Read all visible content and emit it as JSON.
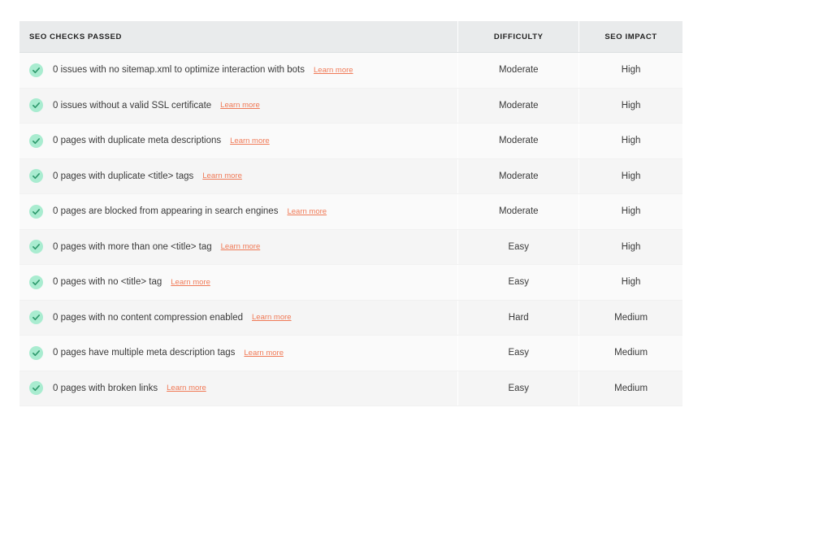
{
  "header": {
    "check_label": "SEO CHECKS PASSED",
    "difficulty_label": "DIFFICULTY",
    "impact_label": "SEO IMPACT"
  },
  "link_label": "Learn more",
  "colors": {
    "check_bg": "#a9ecd0",
    "check_mark": "#2f9a6d",
    "link": "#f07a57"
  },
  "rows": [
    {
      "text": "0 issues with no sitemap.xml to optimize interaction with bots",
      "link": "Learn more",
      "difficulty": "Moderate",
      "impact": "High"
    },
    {
      "text": "0 issues without a valid SSL certificate",
      "link": "Learn more",
      "difficulty": "Moderate",
      "impact": "High"
    },
    {
      "text": "0 pages with duplicate meta descriptions",
      "link": "Learn more",
      "difficulty": "Moderate",
      "impact": "High"
    },
    {
      "text": "0 pages with duplicate <title> tags",
      "link": "Learn more",
      "difficulty": "Moderate",
      "impact": "High"
    },
    {
      "text": "0 pages are blocked from appearing in search engines",
      "link": "Learn more",
      "difficulty": "Moderate",
      "impact": "High"
    },
    {
      "text": "0 pages with more than one <title> tag",
      "link": "Learn more",
      "difficulty": "Easy",
      "impact": "High"
    },
    {
      "text": "0 pages with no <title> tag",
      "link": "Learn more",
      "difficulty": "Easy",
      "impact": "High"
    },
    {
      "text": "0 pages with no content compression enabled",
      "link": "Learn more",
      "difficulty": "Hard",
      "impact": "Medium"
    },
    {
      "text": "0 pages have multiple meta description tags",
      "link": "Learn more",
      "difficulty": "Easy",
      "impact": "Medium"
    },
    {
      "text": "0 pages with broken links",
      "link": "Learn more",
      "difficulty": "Easy",
      "impact": "Medium"
    }
  ]
}
